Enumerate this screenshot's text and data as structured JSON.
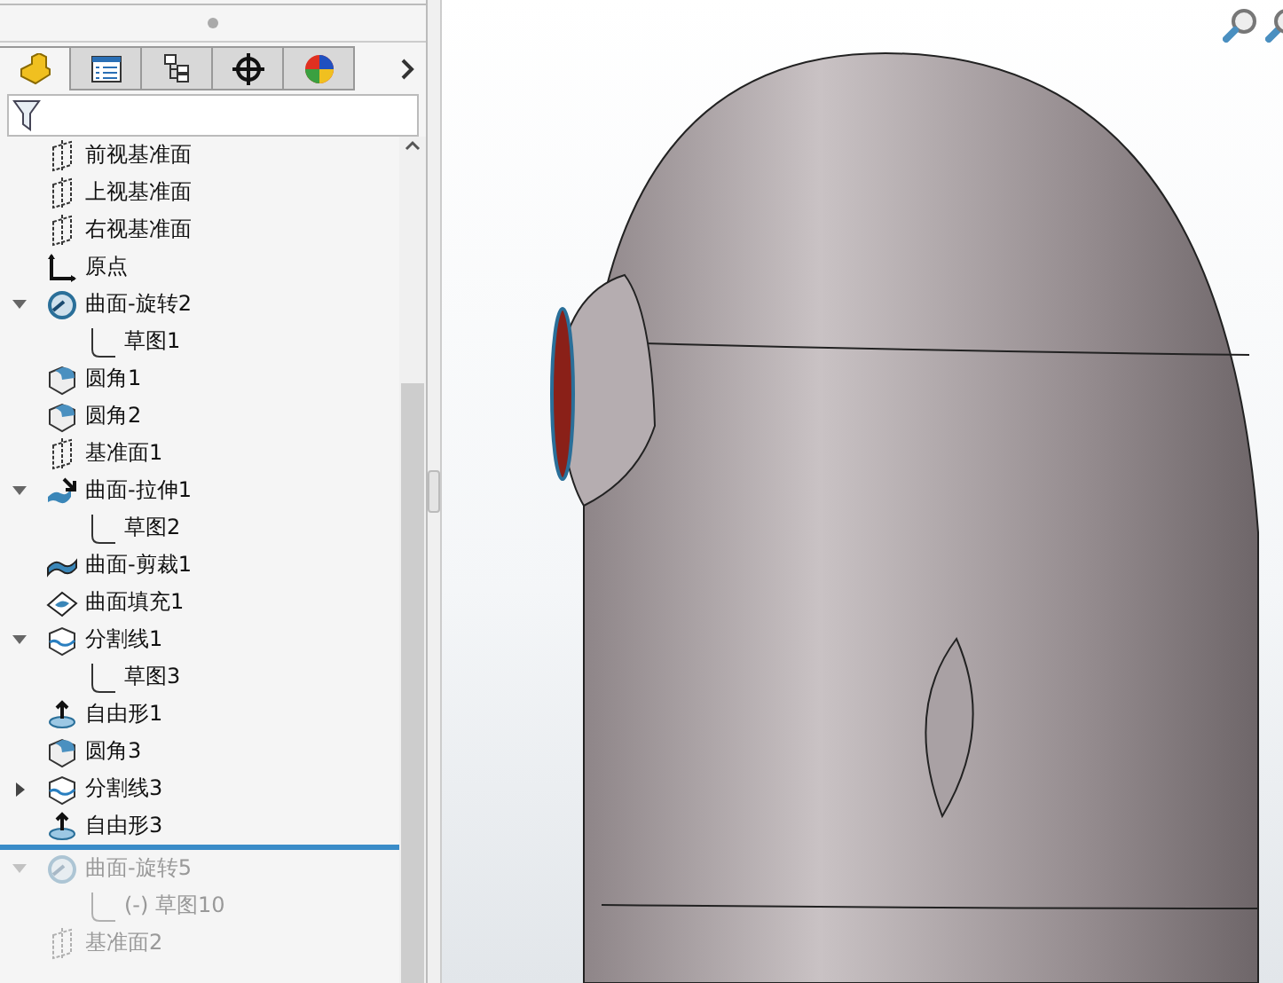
{
  "tabs": [
    {
      "kind": "features",
      "selected": true
    },
    {
      "kind": "properties",
      "selected": false
    },
    {
      "kind": "configurations",
      "selected": false
    },
    {
      "kind": "dimxpert",
      "selected": false
    },
    {
      "kind": "appearance",
      "selected": false
    }
  ],
  "tree": [
    {
      "label": "前视基准面",
      "kind": "plane",
      "rolled_back": false
    },
    {
      "label": "上视基准面",
      "kind": "plane",
      "rolled_back": false
    },
    {
      "label": "右视基准面",
      "kind": "plane",
      "rolled_back": false
    },
    {
      "label": "原点",
      "kind": "origin",
      "rolled_back": false
    },
    {
      "label": "曲面-旋转2",
      "kind": "revolve",
      "expanded": true,
      "rolled_back": false,
      "children": [
        {
          "label": "草图1",
          "kind": "sketch",
          "rolled_back": false
        }
      ]
    },
    {
      "label": "圆角1",
      "kind": "fillet",
      "rolled_back": false
    },
    {
      "label": "圆角2",
      "kind": "fillet",
      "rolled_back": false
    },
    {
      "label": "基准面1",
      "kind": "plane",
      "rolled_back": false
    },
    {
      "label": "曲面-拉伸1",
      "kind": "extrude",
      "expanded": true,
      "rolled_back": false,
      "children": [
        {
          "label": "草图2",
          "kind": "sketch",
          "rolled_back": false
        }
      ]
    },
    {
      "label": "曲面-剪裁1",
      "kind": "trim",
      "rolled_back": false
    },
    {
      "label": "曲面填充1",
      "kind": "fill",
      "rolled_back": false
    },
    {
      "label": "分割线1",
      "kind": "split",
      "expanded": true,
      "rolled_back": false,
      "children": [
        {
          "label": "草图3",
          "kind": "sketch",
          "rolled_back": false
        }
      ]
    },
    {
      "label": "自由形1",
      "kind": "freeform",
      "rolled_back": false
    },
    {
      "label": "圆角3",
      "kind": "fillet",
      "rolled_back": false
    },
    {
      "label": "分割线3",
      "kind": "split",
      "expanded": false,
      "rolled_back": false
    },
    {
      "label": "自由形3",
      "kind": "freeform",
      "rolled_back": false
    },
    {
      "label": "曲面-旋转5",
      "kind": "revolve",
      "expanded": true,
      "rolled_back": true,
      "children": [
        {
          "label": "(-) 草图10",
          "kind": "sketch",
          "rolled_back": true
        }
      ]
    },
    {
      "label": "基准面2",
      "kind": "plane",
      "rolled_back": true
    }
  ]
}
